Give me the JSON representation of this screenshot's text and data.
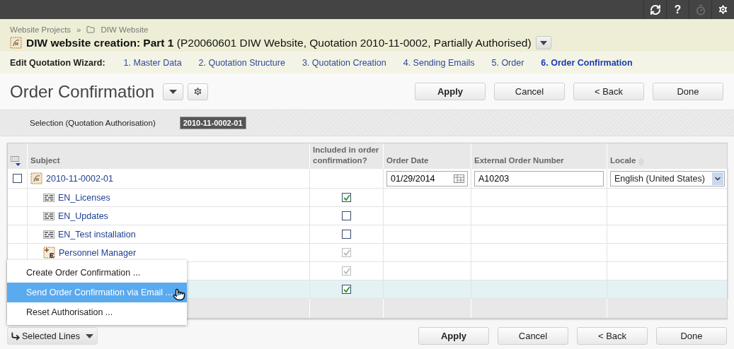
{
  "topbar": {
    "help_label": "?",
    "timer_disabled": true
  },
  "header": {
    "breadcrumbs": [
      {
        "label": "Website Projects",
        "kind": "text"
      },
      {
        "label": "»",
        "kind": "separator"
      },
      {
        "label": "DIW Website",
        "kind": "folder"
      }
    ],
    "title": "**DIW website creation: Part 1** (P20060601 DIW Website, Quotation 2010-11-0002, Partially Authorised)"
  },
  "wizard": {
    "label": "Edit Quotation Wizard:",
    "steps": [
      {
        "label": "1. Master Data",
        "selected": false
      },
      {
        "label": "2. Quotation Structure",
        "selected": false
      },
      {
        "label": "3. Quotation Creation",
        "selected": false
      },
      {
        "label": "4. Sending Emails",
        "selected": false
      },
      {
        "label": "5. Order",
        "selected": false
      },
      {
        "label": "6. Order Confirmation",
        "selected": true
      }
    ]
  },
  "page": {
    "title": "Order Confirmation",
    "buttons": [
      {
        "label": "Apply",
        "primary": true
      },
      {
        "label": "Cancel",
        "primary": false
      },
      {
        "label": "< Back",
        "primary": false
      },
      {
        "label": "Done",
        "primary": false
      }
    ]
  },
  "selection": {
    "label": "Selection (Quotation Authorisation)",
    "value": "2010-11-0002-01"
  },
  "table": {
    "columns": [
      "Subject",
      "Included in order confirmation?",
      "Order Date",
      "External Order Number",
      "Locale"
    ],
    "rows": [
      {
        "subject": "2010-11-0002-01",
        "kind": "quotation",
        "checked": false,
        "order_date": "01/29/2014",
        "external_order_number": "A10203",
        "locale": "English (United States)",
        "children": [
          {
            "subject": "EN_Licenses",
            "kind": "text",
            "included": true,
            "disabled": false,
            "selected": false
          },
          {
            "subject": "EN_Updates",
            "kind": "text",
            "included": false,
            "disabled": false,
            "selected": false
          },
          {
            "subject": "EN_Test installation",
            "kind": "text",
            "included": false,
            "disabled": false,
            "selected": false
          },
          {
            "subject": "Personnel Manager",
            "kind": "personnel",
            "included": true,
            "disabled": true,
            "selected": false
          },
          {
            "included": true,
            "disabled": true,
            "selected": false
          },
          {
            "included": true,
            "disabled": false,
            "selected": true
          }
        ]
      }
    ]
  },
  "context_menu": {
    "items": [
      {
        "label": "Create Order Confirmation ...",
        "selected": false
      },
      {
        "label": "Send Order Confirmation via Email ...",
        "selected": true
      },
      {
        "label": "Reset Authorisation ...",
        "selected": false
      }
    ]
  },
  "footer": {
    "selected_lines": "Selected Lines",
    "buttons": [
      {
        "label": "Apply",
        "primary": true
      },
      {
        "label": "Cancel",
        "primary": false
      },
      {
        "label": "< Back",
        "primary": false
      },
      {
        "label": "Done",
        "primary": false
      }
    ]
  }
}
